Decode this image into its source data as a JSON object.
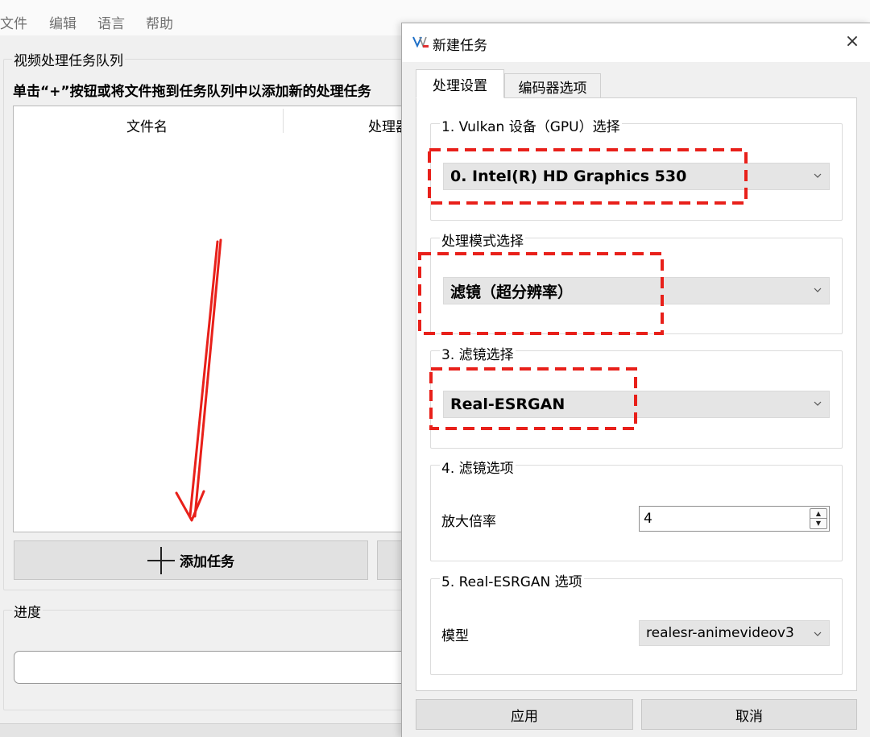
{
  "menu": [
    "文件",
    "编辑",
    "语言",
    "帮助"
  ],
  "queue": {
    "group_title": "视频处理任务队列",
    "hint": "单击“+”按钮或将文件拖到任务队列中以添加新的处理任务",
    "columns": [
      "文件名",
      "处理器"
    ],
    "add_button": "添加任务"
  },
  "progress": {
    "group_title": "进度"
  },
  "dialog": {
    "title": "新建任务",
    "close_symbol": "×",
    "tabs": [
      "处理设置",
      "编码器选项"
    ],
    "active_tab": 0,
    "gpu_section": {
      "title": "1. Vulkan 设备（GPU）选择",
      "value": "0. Intel(R) HD Graphics 530"
    },
    "mode_section": {
      "title": "处理模式选择",
      "value": "滤镜（超分辨率）"
    },
    "filter_section": {
      "title": "3. 滤镜选择",
      "value": "Real-ESRGAN"
    },
    "filter_options": {
      "title": "4. 滤镜选项",
      "scale_label": "放大倍率",
      "scale_value": "4"
    },
    "esrgan_options": {
      "title": "5. Real-ESRGAN 选项",
      "model_label": "模型",
      "model_value": "realesr-animevideov3"
    },
    "apply_button": "应用",
    "cancel_button": "取消"
  },
  "colors": {
    "annotation_red": "#e8201a",
    "combo_bg": "#e5e5e5",
    "button_bg": "#e1e1e1"
  },
  "icons": [
    "app-icon",
    "close-icon",
    "plus-icon",
    "chevron-down-icon",
    "spin-up-icon",
    "spin-down-icon"
  ]
}
